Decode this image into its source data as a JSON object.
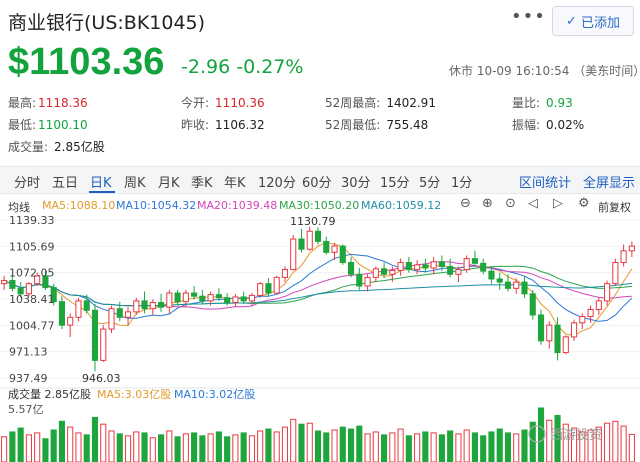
{
  "header": {
    "title": "商业银行(US:BK1045)",
    "more_label": "•••",
    "added_label": "已添加",
    "price": "$1103.36",
    "change": "-2.96",
    "change_pct": "-0.27%",
    "status": "休市 10-09 16:10:54 （美东时间）"
  },
  "stats": [
    {
      "key": "最高:",
      "value": "1118.36",
      "color": "#d9252b"
    },
    {
      "key": "今开:",
      "value": "1110.36",
      "color": "#d9252b"
    },
    {
      "key": "52周最高:",
      "value": "1402.91",
      "color": "#222"
    },
    {
      "key": "量比:",
      "value": "0.93",
      "color": "#12a33c"
    },
    {
      "key": "最低:",
      "value": "1100.10",
      "color": "#12a33c"
    },
    {
      "key": "昨收:",
      "value": "1106.32",
      "color": "#222"
    },
    {
      "key": "52周最低:",
      "value": "755.48",
      "color": "#222"
    },
    {
      "key": "振幅:",
      "value": "0.02%",
      "color": "#222"
    },
    {
      "key": "成交量:",
      "value": "2.85亿股",
      "color": "#222"
    }
  ],
  "tabs": [
    "分时",
    "五日",
    "日K",
    "周K",
    "月K",
    "季K",
    "年K",
    "120分",
    "60分",
    "30分",
    "15分",
    "5分",
    "1分"
  ],
  "active_tab": "日K",
  "right_tabs": [
    "区间统计",
    "全屏显示"
  ],
  "ma_row": {
    "type": "均线",
    "ma5": "MA5:1088.10",
    "ma10": "MA10:1054.32",
    "ma20": "MA20:1039.48",
    "ma30": "MA30:1050.20",
    "ma60": "MA60:1059.12",
    "adjust": "前复权",
    "ma_colors": {
      "ma5": "#e29a2d",
      "ma10": "#2a78d6",
      "ma20": "#d245b9",
      "ma30": "#2fa34a",
      "ma60": "#1e8fa6"
    }
  },
  "tools": [
    "⊖",
    "⊕",
    "⊙",
    "◁",
    "▷",
    "⚙"
  ],
  "chart": {
    "y_ticks": [
      "1139.33",
      "1105.69",
      "1072.05",
      "1038.41",
      "1004.77",
      "971.13",
      "937.49"
    ],
    "high_marker": "1130.79",
    "low_marker": "946.03",
    "vol_legend": {
      "label": "成交量 2.85亿股",
      "ma5": "MA5:3.03亿股",
      "ma10": "MA10:3.02亿股"
    },
    "vol_max": "5.57亿",
    "watermark": "西游投资"
  },
  "chart_data": {
    "type": "candlestick",
    "ylim": [
      937.49,
      1139.33
    ],
    "candles": [
      [
        1058,
        1068,
        1050,
        1062
      ],
      [
        1062,
        1070,
        1048,
        1052
      ],
      [
        1052,
        1060,
        1040,
        1045
      ],
      [
        1045,
        1060,
        1042,
        1058
      ],
      [
        1058,
        1072,
        1055,
        1068
      ],
      [
        1068,
        1075,
        1050,
        1053
      ],
      [
        1053,
        1058,
        1030,
        1035
      ],
      [
        1035,
        1042,
        1000,
        1005
      ],
      [
        1005,
        1020,
        990,
        1015
      ],
      [
        1015,
        1040,
        1010,
        1036
      ],
      [
        1036,
        1044,
        1020,
        1024
      ],
      [
        1024,
        1032,
        946,
        960
      ],
      [
        960,
        1005,
        958,
        1000
      ],
      [
        1000,
        1030,
        995,
        1026
      ],
      [
        1026,
        1035,
        1010,
        1015
      ],
      [
        1015,
        1028,
        1005,
        1022
      ],
      [
        1022,
        1040,
        1018,
        1036
      ],
      [
        1036,
        1048,
        1020,
        1026
      ],
      [
        1026,
        1038,
        1018,
        1034
      ],
      [
        1034,
        1045,
        1022,
        1028
      ],
      [
        1028,
        1050,
        1020,
        1046
      ],
      [
        1046,
        1050,
        1030,
        1035
      ],
      [
        1035,
        1050,
        1028,
        1046
      ],
      [
        1046,
        1055,
        1038,
        1042
      ],
      [
        1042,
        1050,
        1032,
        1036
      ],
      [
        1036,
        1048,
        1030,
        1044
      ],
      [
        1044,
        1052,
        1036,
        1040
      ],
      [
        1040,
        1046,
        1030,
        1034
      ],
      [
        1034,
        1045,
        1028,
        1041
      ],
      [
        1041,
        1048,
        1032,
        1036
      ],
      [
        1036,
        1046,
        1030,
        1043
      ],
      [
        1043,
        1060,
        1040,
        1058
      ],
      [
        1058,
        1065,
        1042,
        1046
      ],
      [
        1046,
        1068,
        1045,
        1066
      ],
      [
        1066,
        1080,
        1060,
        1076
      ],
      [
        1076,
        1120,
        1075,
        1115
      ],
      [
        1115,
        1128,
        1098,
        1102
      ],
      [
        1102,
        1131,
        1100,
        1125
      ],
      [
        1125,
        1130,
        1108,
        1112
      ],
      [
        1112,
        1118,
        1095,
        1098
      ],
      [
        1098,
        1110,
        1088,
        1106
      ],
      [
        1106,
        1108,
        1082,
        1085
      ],
      [
        1085,
        1092,
        1066,
        1070
      ],
      [
        1070,
        1078,
        1050,
        1055
      ],
      [
        1055,
        1070,
        1048,
        1066
      ],
      [
        1066,
        1080,
        1060,
        1077
      ],
      [
        1077,
        1085,
        1065,
        1070
      ],
      [
        1070,
        1080,
        1060,
        1075
      ],
      [
        1075,
        1090,
        1068,
        1085
      ],
      [
        1085,
        1092,
        1072,
        1076
      ],
      [
        1076,
        1088,
        1070,
        1082
      ],
      [
        1082,
        1090,
        1072,
        1078
      ],
      [
        1078,
        1092,
        1070,
        1086
      ],
      [
        1086,
        1094,
        1074,
        1080
      ],
      [
        1080,
        1090,
        1066,
        1070
      ],
      [
        1070,
        1080,
        1060,
        1076
      ],
      [
        1076,
        1094,
        1072,
        1090
      ],
      [
        1090,
        1100,
        1080,
        1084
      ],
      [
        1084,
        1090,
        1070,
        1074
      ],
      [
        1074,
        1080,
        1058,
        1064
      ],
      [
        1064,
        1072,
        1050,
        1060
      ],
      [
        1060,
        1070,
        1048,
        1052
      ],
      [
        1052,
        1065,
        1045,
        1060
      ],
      [
        1060,
        1068,
        1040,
        1045
      ],
      [
        1045,
        1050,
        1012,
        1018
      ],
      [
        1018,
        1025,
        980,
        985
      ],
      [
        985,
        1010,
        975,
        1005
      ],
      [
        1005,
        1015,
        960,
        970
      ],
      [
        970,
        992,
        968,
        990
      ],
      [
        990,
        1012,
        985,
        1008
      ],
      [
        1008,
        1020,
        1000,
        1016
      ],
      [
        1016,
        1030,
        1008,
        1025
      ],
      [
        1025,
        1040,
        1018,
        1036
      ],
      [
        1036,
        1062,
        1030,
        1058
      ],
      [
        1058,
        1090,
        1055,
        1085
      ],
      [
        1085,
        1108,
        1080,
        1100
      ],
      [
        1100,
        1112,
        1092,
        1106
      ]
    ],
    "volumes": [
      2.6,
      3.1,
      3.5,
      2.8,
      3.0,
      2.4,
      3.3,
      4.2,
      3.6,
      3.0,
      2.8,
      4.6,
      3.9,
      3.2,
      2.9,
      2.7,
      3.1,
      3.0,
      2.5,
      2.8,
      3.2,
      2.6,
      2.9,
      3.0,
      2.7,
      2.9,
      3.1,
      2.6,
      2.8,
      3.0,
      2.7,
      3.2,
      3.4,
      3.1,
      3.6,
      4.4,
      3.9,
      4.0,
      3.2,
      3.0,
      3.3,
      3.6,
      3.4,
      3.7,
      2.9,
      3.1,
      2.8,
      3.0,
      3.4,
      2.7,
      2.9,
      3.1,
      3.0,
      2.8,
      3.2,
      2.9,
      3.3,
      3.0,
      2.7,
      3.1,
      3.4,
      3.0,
      2.9,
      3.3,
      4.1,
      5.57,
      4.3,
      4.8,
      3.9,
      3.5,
      3.1,
      3.3,
      3.6,
      4.0,
      4.2,
      3.7,
      2.85
    ],
    "vol_max": 5.57
  }
}
